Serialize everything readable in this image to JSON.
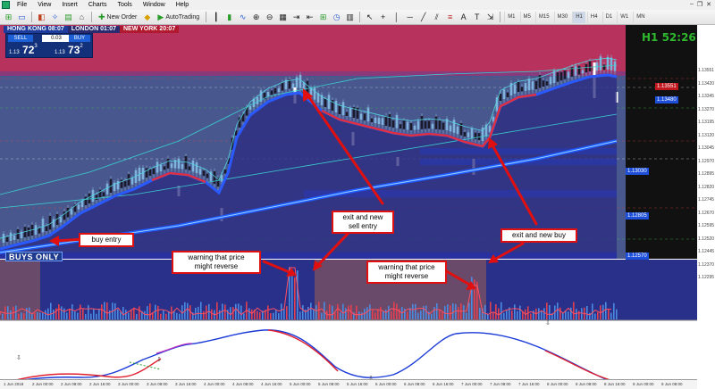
{
  "menu": [
    "File",
    "View",
    "Insert",
    "Charts",
    "Tools",
    "Window",
    "Help"
  ],
  "toolbar": {
    "new_order": "New Order",
    "autotrading": "AutoTrading",
    "timeframes": [
      "M1",
      "M5",
      "M15",
      "M30",
      "H1",
      "H4",
      "D1",
      "W1",
      "MN"
    ],
    "active_timeframe": "H1"
  },
  "sessions": [
    {
      "label": "HONG KONG 08:07",
      "color": "#1e3c9c"
    },
    {
      "label": "LONDON  01:07",
      "color": "#2a2a6e"
    },
    {
      "label": "NEW YORK 20:07",
      "color": "#b11a2e"
    }
  ],
  "trade_panel": {
    "sell_label": "SELL",
    "buy_label": "BUY",
    "lot": "0.03",
    "bid_prefix": "1.13",
    "bid_main": "72",
    "bid_sup": "3",
    "ask_prefix": "1.13",
    "ask_main": "73",
    "ask_sup": "2"
  },
  "timer": "H1 52:26",
  "buys_only": "BUYS ONLY",
  "annotations": {
    "buy_entry": "buy entry",
    "exit_sell": "exit and new\nsell entry",
    "exit_buy": "exit and new buy",
    "warning1": "warning that price\nmight reverse",
    "warning2": "warning that price\nmight reverse"
  },
  "price_levels": [
    "1.13551",
    "1.13420",
    "1.13345",
    "1.13270",
    "1.13195",
    "1.13120",
    "1.13045",
    "1.12970",
    "1.12895",
    "1.12820",
    "1.12745",
    "1.12670",
    "1.12595",
    "1.12520",
    "1.12445",
    "1.12370",
    "1.12295"
  ],
  "price_boxes": [
    {
      "label": "1.13551",
      "color": "#c0181e"
    },
    {
      "label": "1.13480",
      "color": "#1d4fd8"
    },
    {
      "label": "1.13030",
      "color": "#1d4fd8"
    },
    {
      "label": "1.12805",
      "color": "#1d4fd8"
    },
    {
      "label": "1.12570",
      "color": "#1d4fd8"
    }
  ],
  "time_labels": [
    "1 Jun 2018",
    "2 Jun 00:00",
    "2 Jun 08:00",
    "2 Jun 16:00",
    "3 Jun 00:00",
    "3 Jun 08:00",
    "3 Jun 16:00",
    "4 Jun 00:00",
    "4 Jun 08:00",
    "4 Jun 16:00",
    "5 Jun 00:00",
    "5 Jun 08:00",
    "5 Jun 16:00",
    "6 Jun 00:00",
    "6 Jun 08:00",
    "6 Jun 16:00",
    "7 Jun 00:00",
    "7 Jun 08:00",
    "7 Jun 16:00",
    "8 Jun 00:00",
    "8 Jun 08:00",
    "8 Jun 16:00",
    "9 Jun 00:00",
    "9 Jun 08:00"
  ]
}
